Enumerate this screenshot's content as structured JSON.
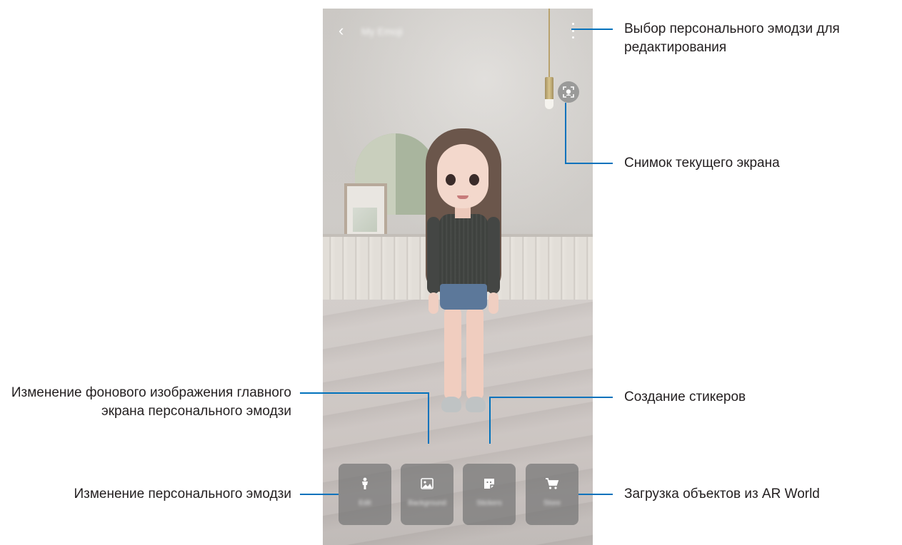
{
  "screen": {
    "title": "My Emoji",
    "actions": [
      {
        "label": "Edit",
        "icon": "person-icon"
      },
      {
        "label": "Background",
        "icon": "image-icon"
      },
      {
        "label": "Stickers",
        "icon": "sticker-icon"
      },
      {
        "label": "Store",
        "icon": "cart-icon"
      }
    ]
  },
  "callouts": {
    "select_emoji": "Выбор персонального эмодзи для редактирования",
    "capture": "Снимок текущего экрана",
    "background": "Изменение фонового изображения главного экрана персонального эмодзи",
    "create_stickers": "Создание стикеров",
    "edit_emoji": "Изменение персонального эмодзи",
    "ar_world": "Загрузка объектов из AR World"
  },
  "colors": {
    "callout_line": "#0072bc",
    "button_bg": "#767676"
  }
}
